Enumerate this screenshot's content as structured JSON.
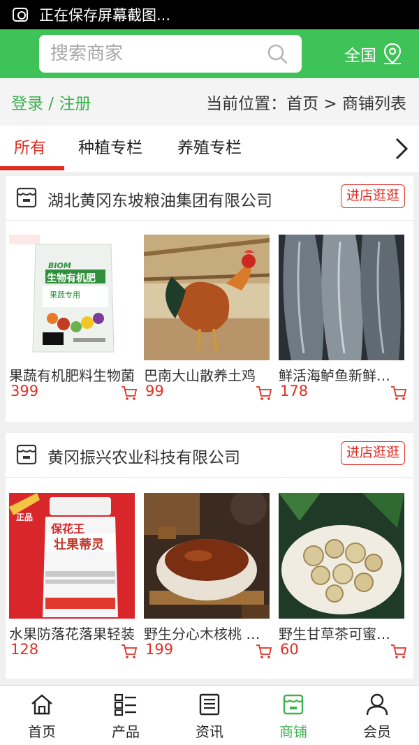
{
  "status_bar": {
    "text": "正在保存屏幕截图..."
  },
  "header": {
    "search_placeholder": "搜索商家",
    "region_label": "全国"
  },
  "crumbbar": {
    "login": "登录 / 注册",
    "location": "当前位置：首页 > 商铺列表"
  },
  "tabs": [
    {
      "label": "所有",
      "active": true
    },
    {
      "label": "种植专栏",
      "active": false
    },
    {
      "label": "养殖专栏",
      "active": false
    }
  ],
  "shops": [
    {
      "name": "湖北黄冈东坡粮油集团有限公司",
      "visit_label": "进店逛逛",
      "products": [
        {
          "name": "果蔬有机肥料生物菌",
          "price": "399",
          "image": "fertilizer-bag"
        },
        {
          "name": "巴南大山散养土鸡",
          "price": "99",
          "image": "rooster"
        },
        {
          "name": "鲜活海鲈鱼新鲜…",
          "price": "178",
          "image": "sea-bass"
        }
      ]
    },
    {
      "name": "黄冈振兴农业科技有限公司",
      "visit_label": "进店逛逛",
      "products": [
        {
          "name": "水果防落花落果轻装",
          "price": "128",
          "image": "bottle-product"
        },
        {
          "name": "野生分心木核桃 …",
          "price": "199",
          "image": "walnut-tea"
        },
        {
          "name": "野生甘草茶可蜜…",
          "price": "60",
          "image": "licorice-slices"
        }
      ]
    }
  ],
  "product_image_text": {
    "fertilizer_brand": "BIOM",
    "fertilizer_title": "生物有机肥",
    "fertilizer_sub": "果蔬专用",
    "bottle_brand": "保花王",
    "bottle_title": "壮果蒂灵",
    "bottle_badge": "正品"
  },
  "bottom_nav": [
    {
      "label": "首页",
      "icon": "home-icon",
      "active": false
    },
    {
      "label": "产品",
      "icon": "grid-list-icon",
      "active": false
    },
    {
      "label": "资讯",
      "icon": "news-icon",
      "active": false
    },
    {
      "label": "商铺",
      "icon": "shop-icon",
      "active": true
    },
    {
      "label": "会员",
      "icon": "user-icon",
      "active": false
    }
  ],
  "colors": {
    "brand_green": "#3fc257",
    "accent_red": "#e02e24"
  }
}
